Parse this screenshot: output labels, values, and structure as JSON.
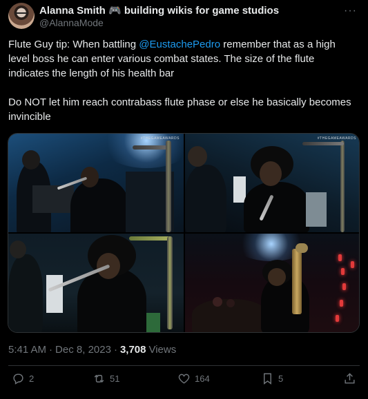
{
  "author": {
    "display_name": "Alanna Smith 🎮 building wikis for game studios",
    "handle": "@AlannaMode",
    "more_label": "···"
  },
  "tweet": {
    "text_part1": "Flute Guy tip: When battling ",
    "mention": "@EustachePedro",
    "text_part2": " remember that as a high level boss he can enter various combat states. The size of the flute indicates the length of his health bar",
    "text_para2": "Do NOT let him reach contrabass flute phase or else he basically becomes invincible"
  },
  "media": {
    "watermark": "#THEGAMEAWARDS",
    "frame_count": 4
  },
  "meta": {
    "time": "5:41 AM",
    "separator1": "·",
    "date": "Dec 8, 2023",
    "separator2": "·",
    "views_count": "3,708",
    "views_label": "Views"
  },
  "actions": {
    "replies": "2",
    "reposts": "51",
    "likes": "164",
    "bookmarks": "5"
  },
  "colors": {
    "background": "#000000",
    "text": "#e7e9ea",
    "secondary": "#71767b",
    "accent": "#1d9bf0",
    "border": "#2f3336"
  },
  "icons": [
    "controller-icon",
    "more-icon",
    "reply-icon",
    "repost-icon",
    "like-icon",
    "bookmark-icon",
    "share-icon"
  ]
}
